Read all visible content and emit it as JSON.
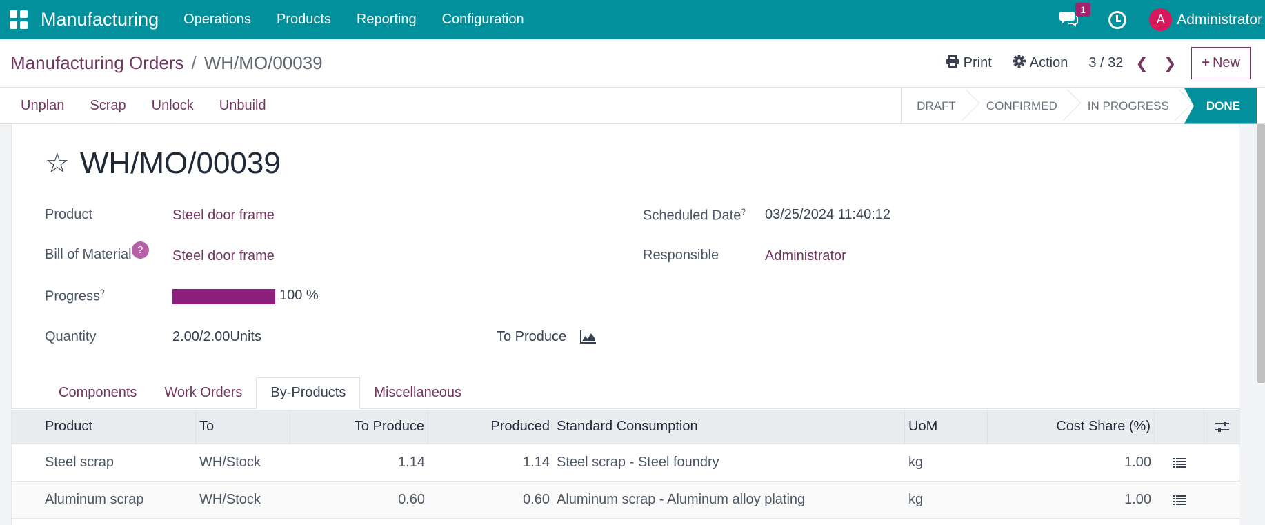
{
  "navbar": {
    "app_name": "Manufacturing",
    "menu": [
      "Operations",
      "Products",
      "Reporting",
      "Configuration"
    ],
    "chat_badge": "1",
    "avatar_initial": "A",
    "user": "Administrator",
    "bg_color": "#01909c"
  },
  "control": {
    "breadcrumb_parent": "Manufacturing Orders",
    "breadcrumb_sep": "/",
    "breadcrumb_current": "WH/MO/00039",
    "print_label": "Print",
    "action_label": "Action",
    "pager": "3 / 32",
    "new_label": "New"
  },
  "statusbar": {
    "buttons": [
      "Unplan",
      "Scrap",
      "Unlock",
      "Unbuild"
    ],
    "stages": [
      "DRAFT",
      "CONFIRMED",
      "IN PROGRESS",
      "DONE"
    ],
    "active_stage": "DONE"
  },
  "form": {
    "title": "WH/MO/00039",
    "product_label": "Product",
    "product_value": "Steel door frame",
    "bom_label": "Bill of Material",
    "bom_help": "?",
    "bom_value": "Steel door frame",
    "progress_label": "Progress",
    "progress_help": "?",
    "progress_value": 100,
    "progress_text": "100 %",
    "quantity_label": "Quantity",
    "quantity_value": "2.00/2.00Units",
    "to_produce_label": "To Produce",
    "scheduled_label": "Scheduled Date",
    "scheduled_help": "?",
    "scheduled_value": "03/25/2024 11:40:12",
    "responsible_label": "Responsible",
    "responsible_value": "Administrator"
  },
  "tabs": [
    {
      "label": "Components",
      "active": false
    },
    {
      "label": "Work Orders",
      "active": false
    },
    {
      "label": "By-Products",
      "active": true
    },
    {
      "label": "Miscellaneous",
      "active": false
    }
  ],
  "table": {
    "headers": [
      "Product",
      "To",
      "To Produce",
      "Produced",
      "Standard Consumption",
      "UoM",
      "Cost Share (%)"
    ],
    "rows": [
      [
        "Steel scrap",
        "WH/Stock",
        "1.14",
        "1.14",
        "Steel scrap - Steel foundry",
        "kg",
        "1.00"
      ],
      [
        "Aluminum scrap",
        "WH/Stock",
        "0.60",
        "0.60",
        "Aluminum scrap - Aluminum alloy plating",
        "kg",
        "1.00"
      ]
    ]
  }
}
